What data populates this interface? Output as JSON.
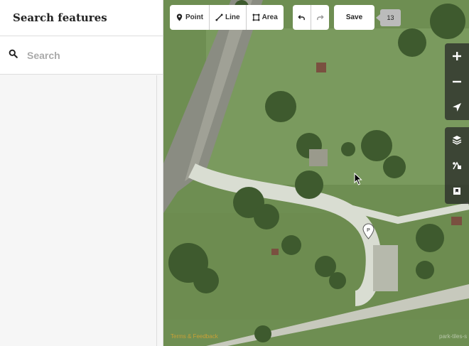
{
  "sidebar": {
    "title": "Search features",
    "search_placeholder": "Search",
    "search_value": ""
  },
  "toolbar": {
    "point_label": "Point",
    "line_label": "Line",
    "area_label": "Area",
    "save_label": "Save",
    "edit_count": "13"
  },
  "map": {
    "attribution": "Terms & Feedback",
    "tile_source": "park-tiles-s",
    "pin_label": "P"
  },
  "colors": {
    "grass": "#6f8f55",
    "path": "#d9ddd2",
    "accent": "#c9a036"
  }
}
